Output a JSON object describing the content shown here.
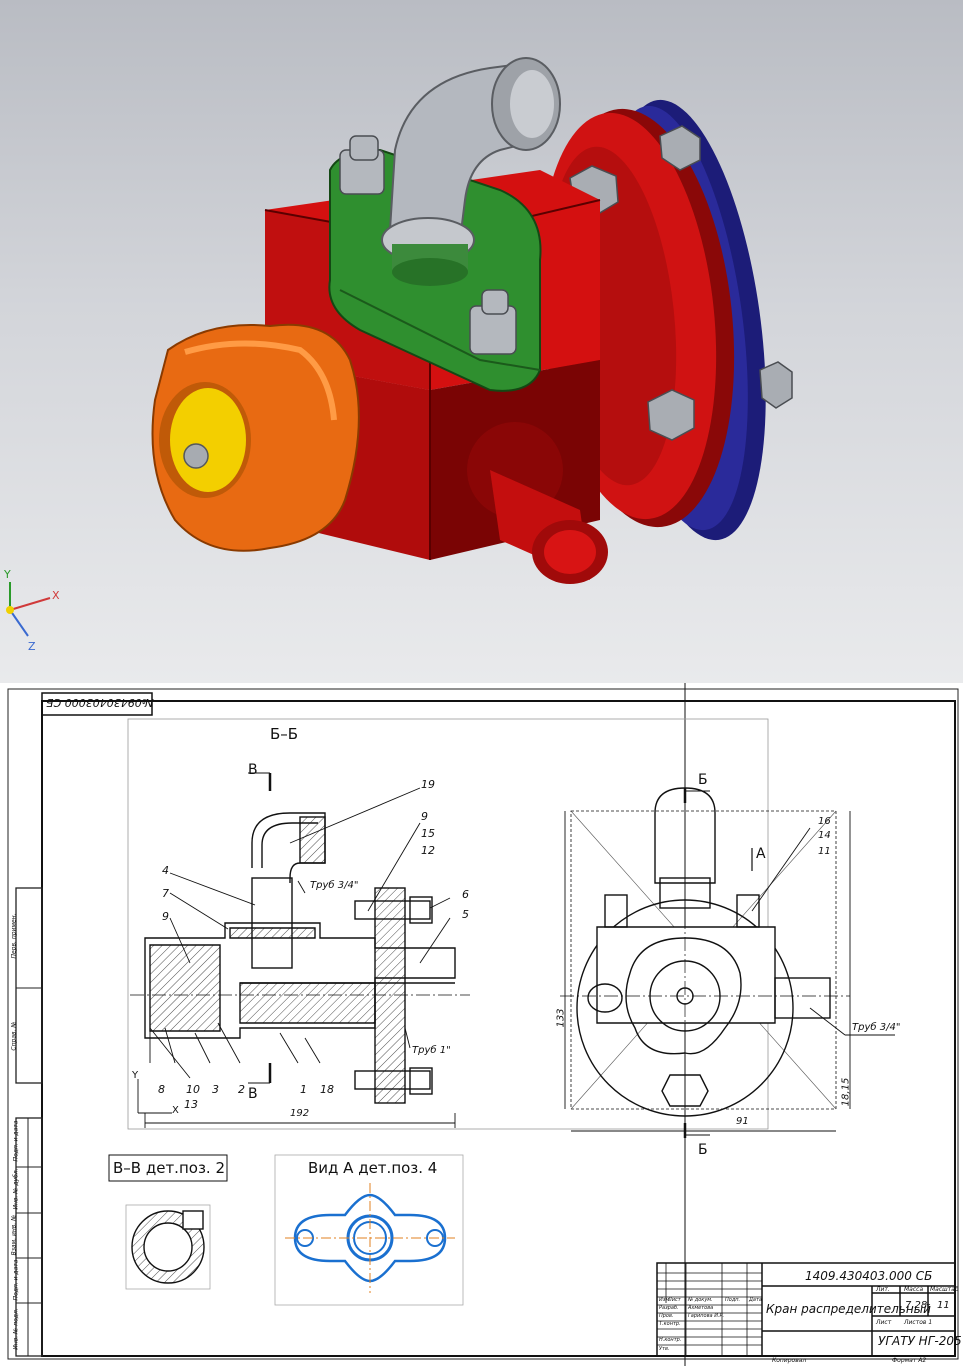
{
  "model_view": {
    "axes": {
      "x": "X",
      "y": "Y",
      "z": "Z"
    },
    "colors": {
      "body": "#c80c0c",
      "flange_cover": "#20208a",
      "handwheel": "#f07820",
      "handwheel_cap": "#f5d000",
      "bracket": "#2c8a2c",
      "metal": "#b8bcc2",
      "background_top": "#b9bcc3",
      "background_bottom": "#e9eaec"
    }
  },
  "drawing": {
    "stamp_code_rotated": "№09430403000 СБ",
    "section_title": "Б–Б",
    "cut_labels": {
      "v_top": "В",
      "v_bottom": "В",
      "b_top": "Б",
      "b_bottom": "Б",
      "view_a": "А"
    },
    "position_numbers": {
      "p19": "19",
      "p9a": "9",
      "p15": "15",
      "p12": "12",
      "p6": "6",
      "p5": "5",
      "p4": "4",
      "p7": "7",
      "p9b": "9",
      "p8": "8",
      "p10": "10",
      "p3": "3",
      "p2": "2",
      "p1": "1",
      "p18": "18",
      "p13": "13",
      "p16": "16",
      "p14": "14",
      "p11": "11"
    },
    "notes": {
      "pipe_top": "Труб 3/4\"",
      "pipe_bottom": "Труб 1\"",
      "pipe_side": "Труб 3/4\""
    },
    "dimensions": {
      "length_main": "192",
      "width_side": "91",
      "height_side": "133",
      "offset_side": "18,15"
    },
    "small_axes": {
      "x": "X",
      "y": "Y"
    },
    "detail_section_title": "В–В дет.поз. 2",
    "detail_view_title": "Вид А дет.поз. 4",
    "title_block": {
      "designation": "1409.430403.000 СБ",
      "name": "Кран распределительный",
      "mass": "7,28",
      "scale": "11",
      "organization": "УГАТУ НГ-205",
      "header_lit": "Лит.",
      "header_mass": "Масса",
      "header_scale": "Масштаб",
      "sheet": "Лист",
      "sheets": "Листов 1",
      "developer_role": "Разраб.",
      "developer_name": "Ахметова",
      "checker_role": "Пров.",
      "checker_name": "Гарипова И.Р.",
      "tcontrol": "Т.контр.",
      "ncontrol": "Н.контр.",
      "approved": "Утв.",
      "change": "Изм.",
      "list": "Лист",
      "doc_no": "№ докум.",
      "sign": "Подп.",
      "date": "Дата",
      "copied": "Копировал",
      "format": "Формат А2"
    },
    "side_stamp": {
      "perv_primen": "Перв. примен.",
      "sprav": "Справ. №",
      "podp_data1": "Подп. и дата",
      "inv_dubl": "Инв. № дубл.",
      "vzam_inv": "Взам. инв. №",
      "podp_data2": "Подп. и дата",
      "inv_podl": "Инв. № подл."
    }
  }
}
